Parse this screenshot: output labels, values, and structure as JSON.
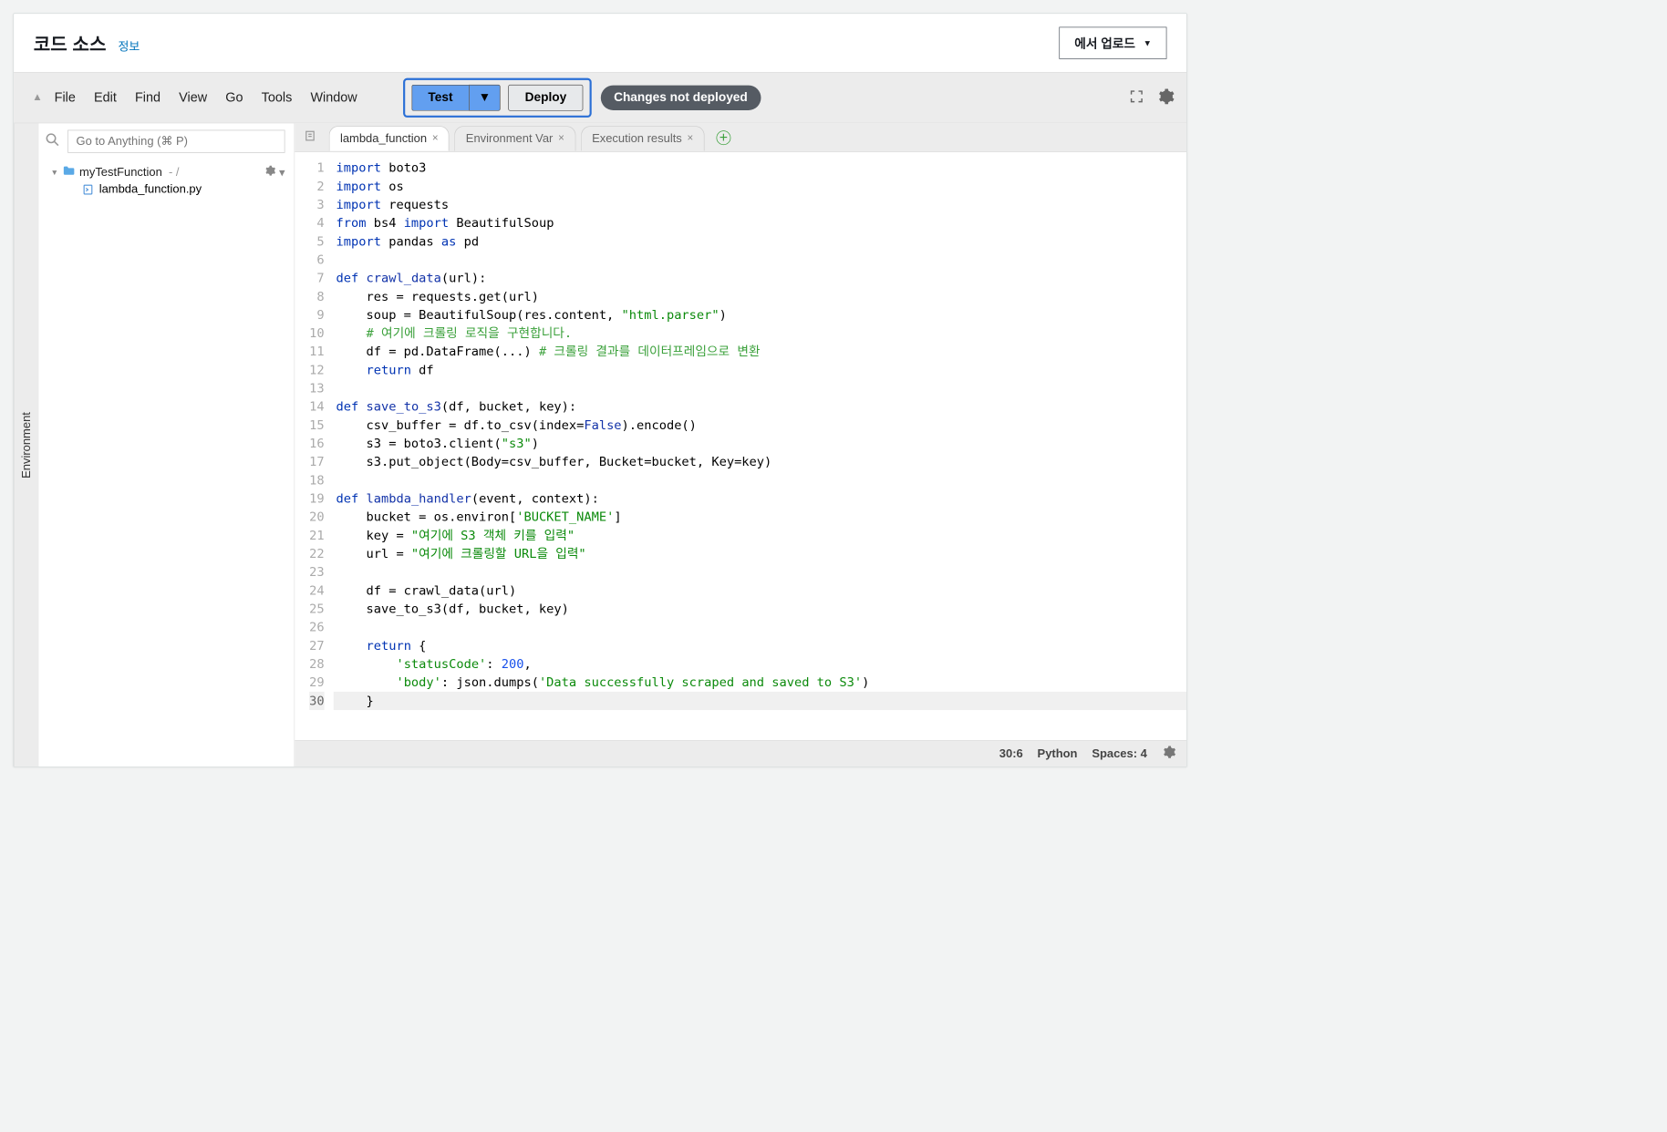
{
  "header": {
    "title": "코드 소스",
    "info_label": "정보",
    "upload_label": "에서 업로드"
  },
  "menu": [
    "File",
    "Edit",
    "Find",
    "View",
    "Go",
    "Tools",
    "Window"
  ],
  "toolbar": {
    "test_label": "Test",
    "deploy_label": "Deploy",
    "status": "Changes not deployed"
  },
  "sidebar": {
    "rail_label": "Environment",
    "goto_placeholder": "Go to Anything (⌘ P)",
    "root_name": "myTestFunction",
    "file_name": "lambda_function.py"
  },
  "tabs": [
    {
      "label": "lambda_function",
      "active": true
    },
    {
      "label": "Environment Var",
      "active": false
    },
    {
      "label": "Execution results",
      "active": false
    }
  ],
  "code": [
    {
      "n": 1,
      "tokens": [
        [
          "kw",
          "import"
        ],
        [
          "",
          " boto3"
        ]
      ]
    },
    {
      "n": 2,
      "tokens": [
        [
          "kw",
          "import"
        ],
        [
          "",
          " os"
        ]
      ]
    },
    {
      "n": 3,
      "tokens": [
        [
          "kw",
          "import"
        ],
        [
          "",
          " requests"
        ]
      ]
    },
    {
      "n": 4,
      "tokens": [
        [
          "kw",
          "from"
        ],
        [
          "",
          " bs4 "
        ],
        [
          "kw",
          "import"
        ],
        [
          "",
          " BeautifulSoup"
        ]
      ]
    },
    {
      "n": 5,
      "tokens": [
        [
          "kw",
          "import"
        ],
        [
          "",
          " pandas "
        ],
        [
          "kw",
          "as"
        ],
        [
          "",
          " pd"
        ]
      ]
    },
    {
      "n": 6,
      "tokens": []
    },
    {
      "n": 7,
      "tokens": [
        [
          "kw",
          "def"
        ],
        [
          "",
          " "
        ],
        [
          "const",
          "crawl_data"
        ],
        [
          "",
          "(url):"
        ]
      ]
    },
    {
      "n": 8,
      "tokens": [
        [
          "",
          "    res = requests.get(url)"
        ]
      ]
    },
    {
      "n": 9,
      "tokens": [
        [
          "",
          "    soup = BeautifulSoup(res.content, "
        ],
        [
          "str",
          "\"html.parser\""
        ],
        [
          "",
          ")"
        ]
      ]
    },
    {
      "n": 10,
      "tokens": [
        [
          "",
          "    "
        ],
        [
          "cmt",
          "# 여기에 크롤링 로직을 구현합니다."
        ]
      ]
    },
    {
      "n": 11,
      "tokens": [
        [
          "",
          "    df = pd.DataFrame(...) "
        ],
        [
          "cmt",
          "# 크롤링 결과를 데이터프레임으로 변환"
        ]
      ]
    },
    {
      "n": 12,
      "tokens": [
        [
          "",
          "    "
        ],
        [
          "kw",
          "return"
        ],
        [
          "",
          " df"
        ]
      ]
    },
    {
      "n": 13,
      "tokens": []
    },
    {
      "n": 14,
      "tokens": [
        [
          "kw",
          "def"
        ],
        [
          "",
          " "
        ],
        [
          "const",
          "save_to_s3"
        ],
        [
          "",
          "(df, bucket, key):"
        ]
      ]
    },
    {
      "n": 15,
      "tokens": [
        [
          "",
          "    csv_buffer = df.to_csv(index="
        ],
        [
          "const",
          "False"
        ],
        [
          "",
          ").encode()"
        ]
      ]
    },
    {
      "n": 16,
      "tokens": [
        [
          "",
          "    s3 = boto3.client("
        ],
        [
          "str",
          "\"s3\""
        ],
        [
          "",
          ")"
        ]
      ]
    },
    {
      "n": 17,
      "tokens": [
        [
          "",
          "    s3.put_object(Body=csv_buffer, Bucket=bucket, Key=key)"
        ]
      ]
    },
    {
      "n": 18,
      "tokens": []
    },
    {
      "n": 19,
      "tokens": [
        [
          "kw",
          "def"
        ],
        [
          "",
          " "
        ],
        [
          "const",
          "lambda_handler"
        ],
        [
          "",
          "(event, context):"
        ]
      ]
    },
    {
      "n": 20,
      "tokens": [
        [
          "",
          "    bucket = os.environ["
        ],
        [
          "str",
          "'BUCKET_NAME'"
        ],
        [
          "",
          "]"
        ]
      ]
    },
    {
      "n": 21,
      "tokens": [
        [
          "",
          "    key = "
        ],
        [
          "str",
          "\"여기에 S3 객체 키를 입력\""
        ]
      ]
    },
    {
      "n": 22,
      "tokens": [
        [
          "",
          "    url = "
        ],
        [
          "str",
          "\"여기에 크롤링할 URL을 입력\""
        ]
      ]
    },
    {
      "n": 23,
      "tokens": []
    },
    {
      "n": 24,
      "tokens": [
        [
          "",
          "    df = crawl_data(url)"
        ]
      ]
    },
    {
      "n": 25,
      "tokens": [
        [
          "",
          "    save_to_s3(df, bucket, key)"
        ]
      ]
    },
    {
      "n": 26,
      "tokens": []
    },
    {
      "n": 27,
      "tokens": [
        [
          "",
          "    "
        ],
        [
          "kw",
          "return"
        ],
        [
          "",
          " {"
        ]
      ]
    },
    {
      "n": 28,
      "tokens": [
        [
          "",
          "        "
        ],
        [
          "str",
          "'statusCode'"
        ],
        [
          "",
          ": "
        ],
        [
          "num",
          "200"
        ],
        [
          "",
          ","
        ]
      ]
    },
    {
      "n": 29,
      "tokens": [
        [
          "",
          "        "
        ],
        [
          "str",
          "'body'"
        ],
        [
          "",
          ": json.dumps("
        ],
        [
          "str",
          "'Data successfully scraped and saved to S3'"
        ],
        [
          "",
          ")"
        ]
      ]
    },
    {
      "n": 30,
      "tokens": [
        [
          "",
          "    }"
        ]
      ],
      "current": true
    }
  ],
  "status": {
    "cursor": "30:6",
    "language": "Python",
    "spaces": "Spaces: 4"
  }
}
